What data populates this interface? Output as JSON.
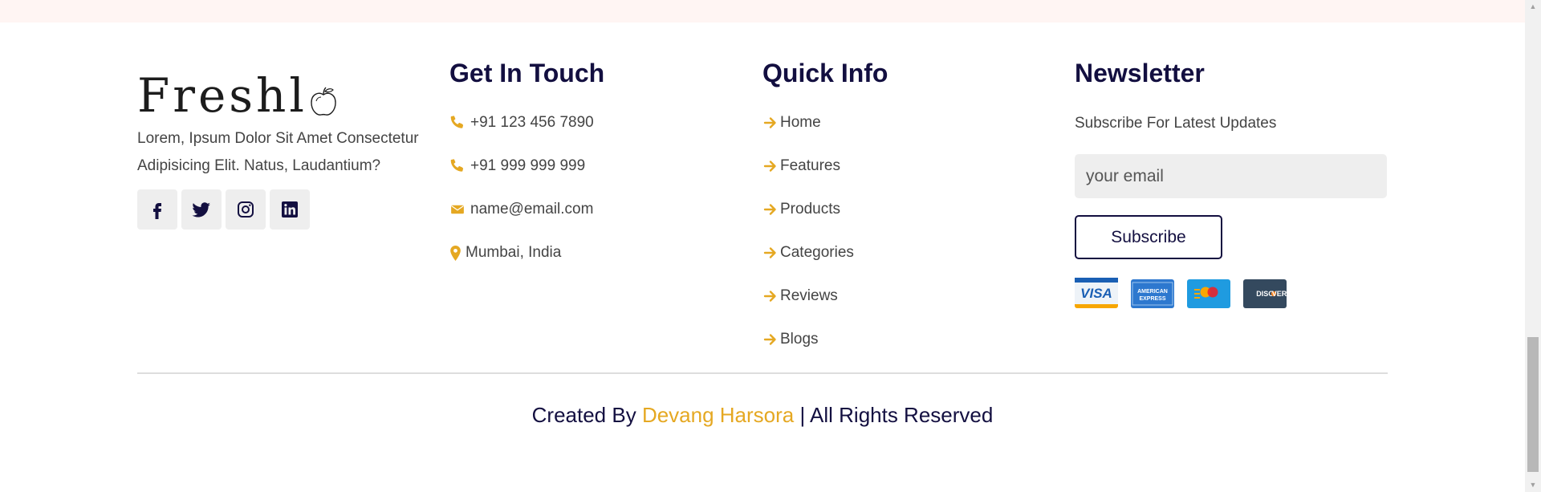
{
  "brand": {
    "logo_text": "Freshl",
    "description": "Lorem, Ipsum Dolor Sit Amet Consectetur Adipisicing Elit. Natus, Laudantium?",
    "social": [
      "facebook-icon",
      "twitter-icon",
      "instagram-icon",
      "linkedin-icon"
    ]
  },
  "contact": {
    "title": "Get In Touch",
    "items": [
      {
        "icon": "phone-icon",
        "text": "+91 123 456 7890"
      },
      {
        "icon": "phone-icon",
        "text": "+91 999 999 999"
      },
      {
        "icon": "envelope-icon",
        "text": "name@email.com"
      },
      {
        "icon": "map-marker-icon",
        "text": "Mumbai, India"
      }
    ]
  },
  "quick_info": {
    "title": "Quick Info",
    "links": [
      "Home",
      "Features",
      "Products",
      "Categories",
      "Reviews",
      "Blogs"
    ]
  },
  "newsletter": {
    "title": "Newsletter",
    "subtitle": "Subscribe For Latest Updates",
    "email_placeholder": "your email",
    "email_value": "",
    "button_label": "Subscribe",
    "payment_cards": [
      "visa-card-icon",
      "amex-card-icon",
      "mastercard-card-icon",
      "discover-card-icon"
    ]
  },
  "footer_credit": {
    "prefix": "Created By ",
    "author": "Devang Harsora",
    "suffix": " | All Rights Reserved"
  },
  "colors": {
    "accent": "#e5a822",
    "primary": "#130f40",
    "text": "#444444",
    "top_band": "#fff5f3"
  }
}
